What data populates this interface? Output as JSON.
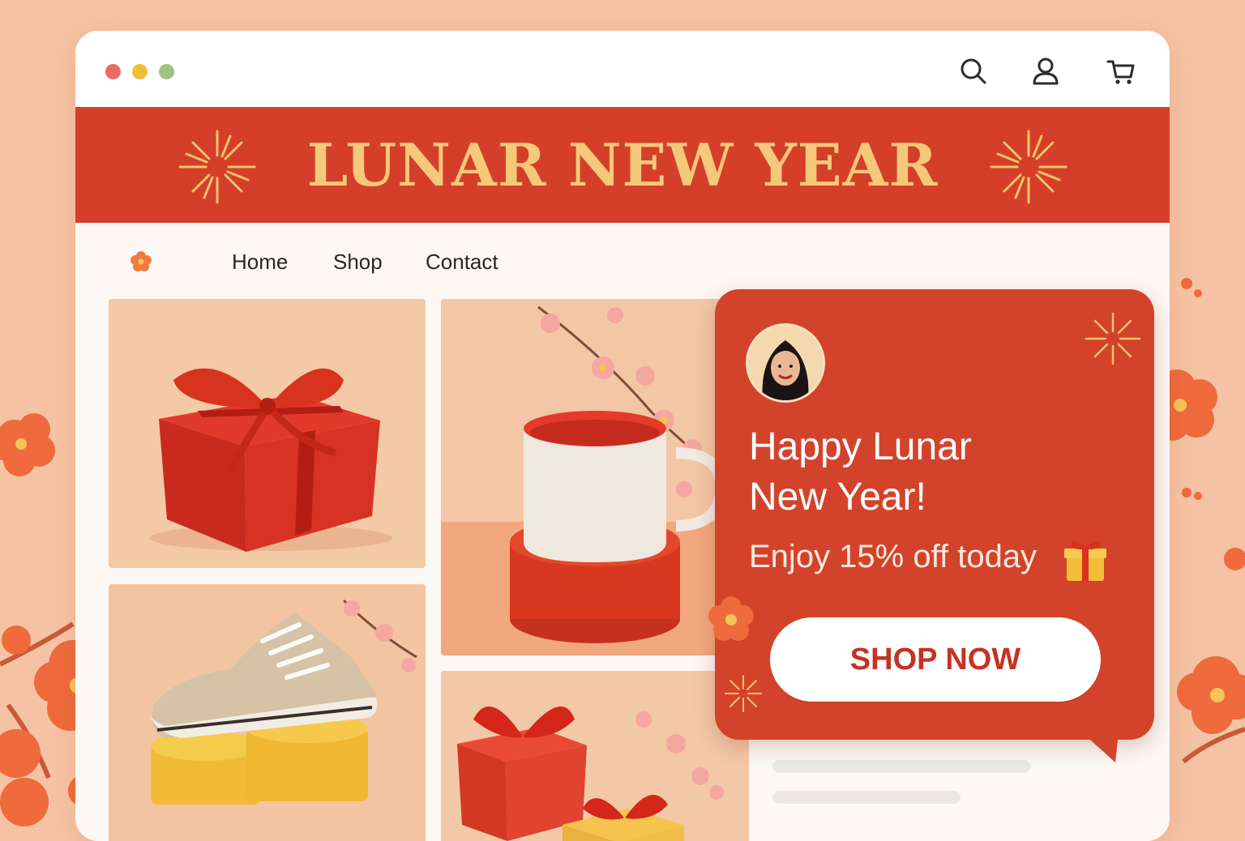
{
  "window": {
    "controls": [
      "close",
      "minimize",
      "maximize"
    ],
    "toolbar_icons": [
      "search-icon",
      "user-icon",
      "cart-icon"
    ]
  },
  "banner": {
    "title": "LUNAR NEW YEAR",
    "background": "#d53f2a",
    "text_color": "#f6c87a"
  },
  "nav": {
    "logo_icon": "blossom-icon",
    "items": [
      {
        "label": "Home"
      },
      {
        "label": "Shop"
      },
      {
        "label": "Contact"
      }
    ]
  },
  "products": [
    {
      "name": "red-gift-box"
    },
    {
      "name": "mug-on-red-stand"
    },
    {
      "name": "sneaker-on-yellow-stand"
    },
    {
      "name": "gift-boxes-with-blossoms"
    }
  ],
  "popup": {
    "title_line1": "Happy Lunar",
    "title_line2": "New Year!",
    "subtitle": "Enjoy 15% off today",
    "button_label": "SHOP NOW",
    "background": "#d3432b",
    "button_text_color": "#c53223"
  }
}
